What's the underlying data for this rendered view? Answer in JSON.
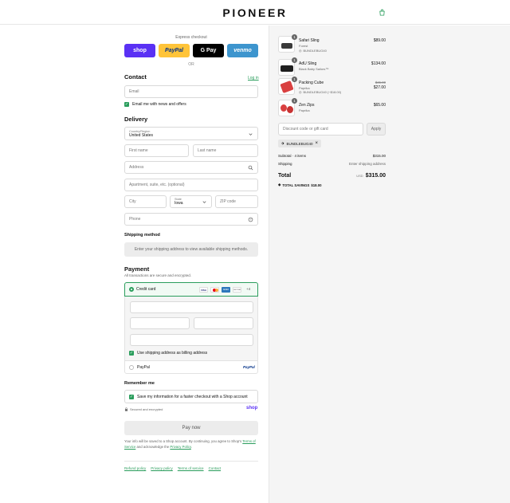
{
  "brand": {
    "name": "PIONEER"
  },
  "express": {
    "label": "Express checkout",
    "buttons": [
      {
        "label": "shop",
        "bg": "#5a31f4",
        "fg": "#ffffff"
      },
      {
        "label": "PayPal",
        "bg": "#ffc439",
        "fg": "#003087"
      },
      {
        "label": "G Pay",
        "bg": "#000000",
        "fg": "#ffffff"
      },
      {
        "label": "venmo",
        "bg": "#3d95ce",
        "fg": "#ffffff"
      }
    ],
    "or_label": "OR"
  },
  "contact": {
    "title": "Contact",
    "login_link": "Log in",
    "email_placeholder": "Email",
    "news_label": "Email me with news and offers"
  },
  "delivery": {
    "title": "Delivery",
    "country_label": "Country/Region",
    "country_value": "United States",
    "first_name": "First name",
    "last_name": "Last name",
    "address": "Address",
    "apartment": "Apartment, suite, etc. (optional)",
    "city": "City",
    "state_label": "State",
    "state_value": "Iowa",
    "zip": "ZIP code",
    "phone": "Phone"
  },
  "shipping_method": {
    "title": "Shipping method",
    "notice": "Enter your shipping address to view available shipping methods."
  },
  "payment": {
    "title": "Payment",
    "subtitle": "All transactions are secure and encrypted.",
    "credit_card": "Credit card",
    "card_brands": [
      "VISA",
      "MC",
      "AMEX",
      "DISCOVER",
      "+4"
    ],
    "billing_label": "Use shipping address as billing address",
    "paypal": "PayPal",
    "paypal_logo": "PayPal"
  },
  "remember": {
    "title": "Remember me",
    "save_label": "Save my information for a faster checkout with a Shop account",
    "secure": "Secured and encrypted",
    "shop_logo": "shop"
  },
  "pay_now": "Pay now",
  "legal": {
    "text_before": "Your info will be saved to a Shop account. By continuing, you agree to Shop’s",
    "terms": "Terms of Service",
    "and_ack": "and acknowledge the",
    "privacy": "Privacy Policy",
    "period": "."
  },
  "footer_links": [
    "Refund policy",
    "Privacy policy",
    "Terms of service",
    "Contact"
  ],
  "cart": {
    "items": [
      {
        "qty": "1",
        "name": "Safari Sling",
        "variant": "Forest",
        "discount": "BUNDLEBUG40",
        "price": "$89.00",
        "original": "",
        "thumb_color": "#3a3a3a"
      },
      {
        "qty": "1",
        "name": "AdU Sling",
        "variant": "Black Baby Sailors™",
        "discount": "",
        "price": "$134.00",
        "original": "",
        "thumb_color": "#1f1f1f"
      },
      {
        "qty": "1",
        "name": "Packing Cube",
        "variant": "Paprika",
        "discount": "BUNDLEBUG40 (−$18.00)",
        "price": "$27.00",
        "original": "$45.00",
        "thumb_color": "#d94040"
      },
      {
        "qty": "1",
        "name": "Zen Zips",
        "variant": "Paprika",
        "discount": "",
        "price": "$65.00",
        "original": "",
        "thumb_color": "#d94040"
      }
    ],
    "discount_placeholder": "Discount code or gift card",
    "apply": "Apply",
    "code_chip": "BUNDLEBUG40",
    "subtotal_label": "Subtotal · 4 items",
    "subtotal_value": "$315.00",
    "shipping_label": "Shipping",
    "shipping_value": "Enter shipping address",
    "total_label": "Total",
    "currency": "USD",
    "total_value": "$315.00",
    "savings_label": "TOTAL SAVINGS",
    "savings_value": "$18.00"
  },
  "colors": {
    "accent": "#2a9d5c",
    "shop": "#5a31f4"
  }
}
